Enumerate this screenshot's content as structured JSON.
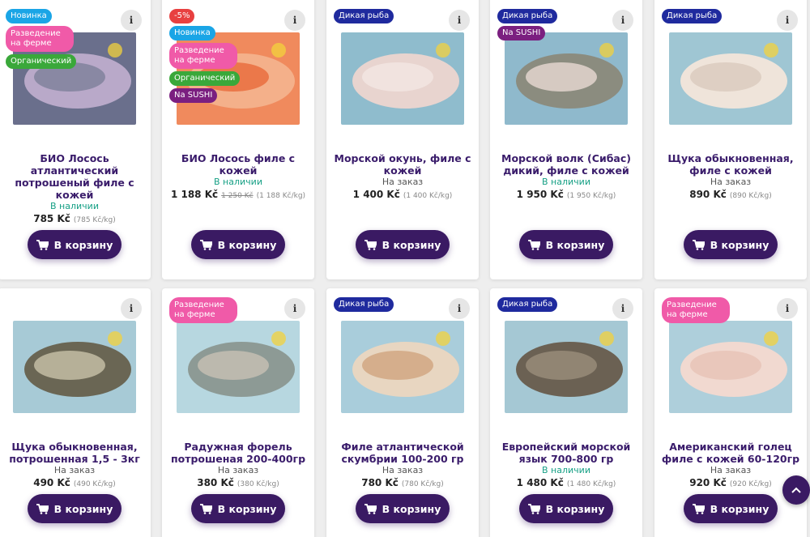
{
  "colors": {
    "novinka": "#1aa5e6",
    "farm": "#f05aa8",
    "organic": "#3aa83a",
    "sushi": "#7b1f80",
    "wild": "#1f2a9e",
    "discount": "#e84040",
    "button": "#3a1a63"
  },
  "cart_label": "В корзину",
  "products": [
    {
      "badges": [
        {
          "text": "Новинка",
          "type": "novinka"
        },
        {
          "text": "Разведение на ферме",
          "type": "farm"
        },
        {
          "text": "Органический",
          "type": "organic"
        }
      ],
      "title": "БИО Лосось атлантический потрошеный филе с кожей",
      "status": "В наличии",
      "price": "785 Kč",
      "old_price": "",
      "per_kg": "(785 Kč/kg)"
    },
    {
      "badges": [
        {
          "text": "-5%",
          "type": "discount"
        },
        {
          "text": "Новинка",
          "type": "novinka"
        },
        {
          "text": "Разведение на ферме",
          "type": "farm"
        },
        {
          "text": "Органический",
          "type": "organic"
        },
        {
          "text": "Na SUSHI",
          "type": "sushi"
        }
      ],
      "title": "БИО Лосось филе с кожей",
      "status": "В наличии",
      "price": "1 188 Kč",
      "old_price": "1 250 Kč",
      "per_kg": "(1 188 Kč/kg)"
    },
    {
      "badges": [
        {
          "text": "Дикая рыба",
          "type": "wild"
        }
      ],
      "title": "Морской окунь, филе с кожей",
      "status": "На заказ",
      "price": "1 400 Kč",
      "old_price": "",
      "per_kg": "(1 400 Kč/kg)"
    },
    {
      "badges": [
        {
          "text": "Дикая рыба",
          "type": "wild"
        },
        {
          "text": "Na SUSHI",
          "type": "sushi"
        }
      ],
      "title": "Морской волк (Сибас) дикий, филе с кожей",
      "status": "В наличии",
      "price": "1 950 Kč",
      "old_price": "",
      "per_kg": "(1 950 Kč/kg)"
    },
    {
      "badges": [
        {
          "text": "Дикая рыба",
          "type": "wild"
        }
      ],
      "title": "Щука обыкновенная, филе с кожей",
      "status": "На заказ",
      "price": "890 Kč",
      "old_price": "",
      "per_kg": "(890 Kč/kg)"
    },
    {
      "badges": [],
      "title": "Щука обыкновенная, потрошенная 1,5 - 3кг",
      "status": "На заказ",
      "price": "490 Kč",
      "old_price": "",
      "per_kg": "(490 Kč/kg)"
    },
    {
      "badges": [
        {
          "text": "Разведение на ферме",
          "type": "farm"
        }
      ],
      "title": "Радужная форель потрошеная 200-400гр",
      "status": "На заказ",
      "price": "380 Kč",
      "old_price": "",
      "per_kg": "(380 Kč/kg)"
    },
    {
      "badges": [
        {
          "text": "Дикая рыба",
          "type": "wild"
        }
      ],
      "title": "Филе атлантической скумбрии 100-200 гр",
      "status": "На заказ",
      "price": "780 Kč",
      "old_price": "",
      "per_kg": "(780 Kč/kg)"
    },
    {
      "badges": [
        {
          "text": "Дикая рыба",
          "type": "wild"
        }
      ],
      "title": "Европейский морской язык 700-800 гр",
      "status": "В наличии",
      "price": "1 480 Kč",
      "old_price": "",
      "per_kg": "(1 480 Kč/kg)"
    },
    {
      "badges": [
        {
          "text": "Разведение на ферме",
          "type": "farm"
        }
      ],
      "title": "Американский голец филе с кожей 60-120гр",
      "status": "На заказ",
      "price": "920 Kč",
      "old_price": "",
      "per_kg": "(920 Kč/kg)"
    }
  ]
}
